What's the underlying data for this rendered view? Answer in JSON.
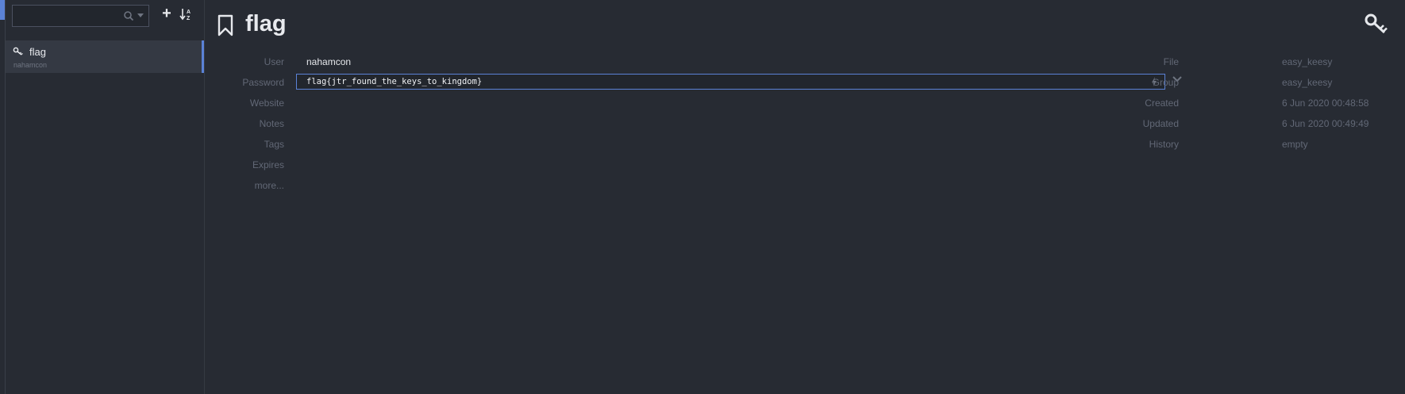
{
  "sidebar": {
    "search": {
      "placeholder": "",
      "value": ""
    },
    "add_label": "+",
    "entries": [
      {
        "title": "flag",
        "subtitle": "nahamcon",
        "icon": "key-icon"
      }
    ]
  },
  "entry": {
    "title": "flag",
    "fields": {
      "user_label": "User",
      "user_value": "nahamcon",
      "password_label": "Password",
      "password_value": "flag{jtr_found_the_keys_to_kingdom}",
      "website_label": "Website",
      "notes_label": "Notes",
      "tags_label": "Tags",
      "expires_label": "Expires",
      "more_label": "more..."
    },
    "meta": {
      "file_label": "File",
      "file_value": "easy_keesy",
      "group_label": "Group",
      "group_value": "easy_keesy",
      "created_label": "Created",
      "created_value": "6 Jun 2020 00:48:58",
      "updated_label": "Updated",
      "updated_value": "6 Jun 2020 00:49:49",
      "history_label": "History",
      "history_value": "empty"
    }
  },
  "colors": {
    "accent": "#5b82d6",
    "background": "#272b33",
    "selected": "#343943"
  }
}
